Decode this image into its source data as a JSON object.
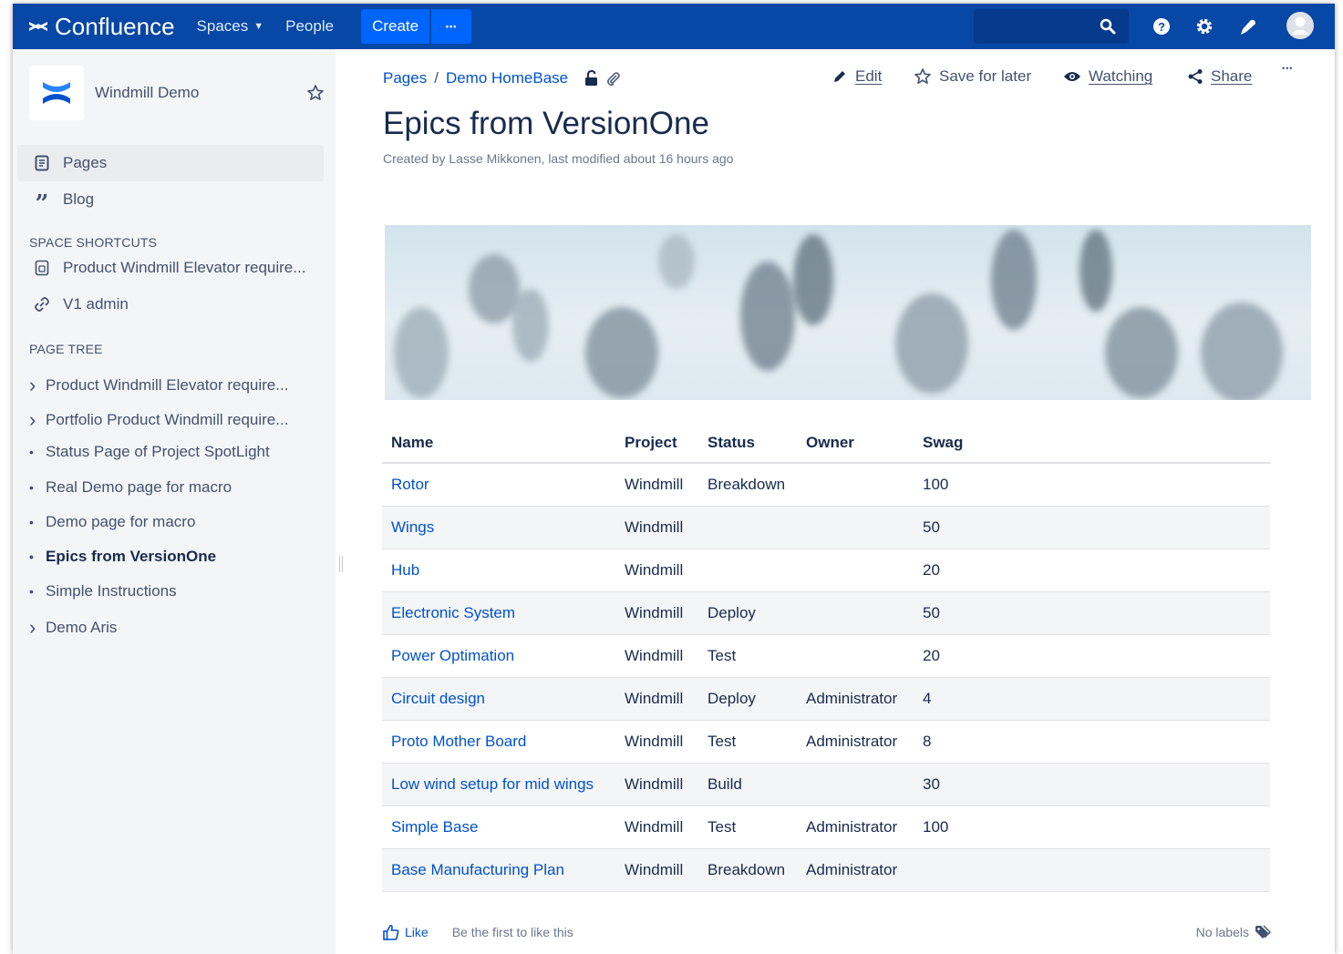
{
  "nav": {
    "brand": "Confluence",
    "spaces": "Spaces",
    "people": "People",
    "create": "Create",
    "more": "•••",
    "icons": [
      "search-icon",
      "help-icon",
      "settings-icon",
      "notifications-icon",
      "avatar"
    ]
  },
  "sidebar": {
    "space_name": "Windmill Demo",
    "links": [
      {
        "label": "Pages",
        "icon": "pages-icon"
      },
      {
        "label": "Blog",
        "icon": "blog-icon"
      }
    ],
    "shortcuts_heading": "SPACE SHORTCUTS",
    "shortcuts": [
      {
        "label": "Product Windmill Elevator require...",
        "icon": "page-icon"
      },
      {
        "label": "V1 admin",
        "icon": "link-icon"
      }
    ],
    "tree_heading": "PAGE TREE",
    "tree": [
      {
        "label": "Product Windmill Elevator require...",
        "marker": "›"
      },
      {
        "label": "Portfolio Product Windmill require...",
        "marker": "›"
      },
      {
        "label": "Status Page of Project SpotLight",
        "marker": "•"
      },
      {
        "label": "Real Demo page for macro",
        "marker": "•"
      },
      {
        "label": "Demo page for macro",
        "marker": "•"
      },
      {
        "label": "Epics from VersionOne",
        "marker": "•"
      },
      {
        "label": "Simple Instructions",
        "marker": "•"
      },
      {
        "label": "Demo Aris",
        "marker": "›"
      }
    ]
  },
  "page": {
    "breadcrumb": [
      "Pages",
      "Demo HomeBase"
    ],
    "actions": {
      "edit": "Edit",
      "save": "Save for later",
      "watching": "Watching",
      "share": "Share",
      "more": "•••"
    },
    "title": "Epics from VersionOne",
    "byline": "Created by Lasse Mikkonen, last modified about 16 hours ago"
  },
  "table": {
    "headers": [
      "Name",
      "Project",
      "Status",
      "Owner",
      "Swag"
    ],
    "rows": [
      [
        "Rotor",
        "Windmill",
        "Breakdown",
        "",
        "100"
      ],
      [
        "Wings",
        "Windmill",
        "",
        "",
        "50"
      ],
      [
        "Hub",
        "Windmill",
        "",
        "",
        "20"
      ],
      [
        "Electronic System",
        "Windmill",
        "Deploy",
        "",
        "50"
      ],
      [
        "Power Optimation",
        "Windmill",
        "Test",
        "",
        "20"
      ],
      [
        "Circuit design",
        "Windmill",
        "Deploy",
        "Administrator",
        "4"
      ],
      [
        "Proto Mother Board",
        "Windmill",
        "Test",
        "Administrator",
        "8"
      ],
      [
        "Low wind setup for mid wings",
        "Windmill",
        "Build",
        "",
        "30"
      ],
      [
        "Simple Base",
        "Windmill",
        "Test",
        "Administrator",
        "100"
      ],
      [
        "Base Manufacturing Plan",
        "Windmill",
        "Breakdown",
        "Administrator",
        ""
      ]
    ]
  },
  "footer": {
    "like": "Like",
    "like_prompt": "Be the first to like this",
    "labels": "No labels"
  },
  "colors": {
    "nav_bg": "#0747a6",
    "create_bg": "#0065ff",
    "link": "#0052cc",
    "sidebar_bg": "#f4f5f7",
    "text": "#172b4d"
  }
}
